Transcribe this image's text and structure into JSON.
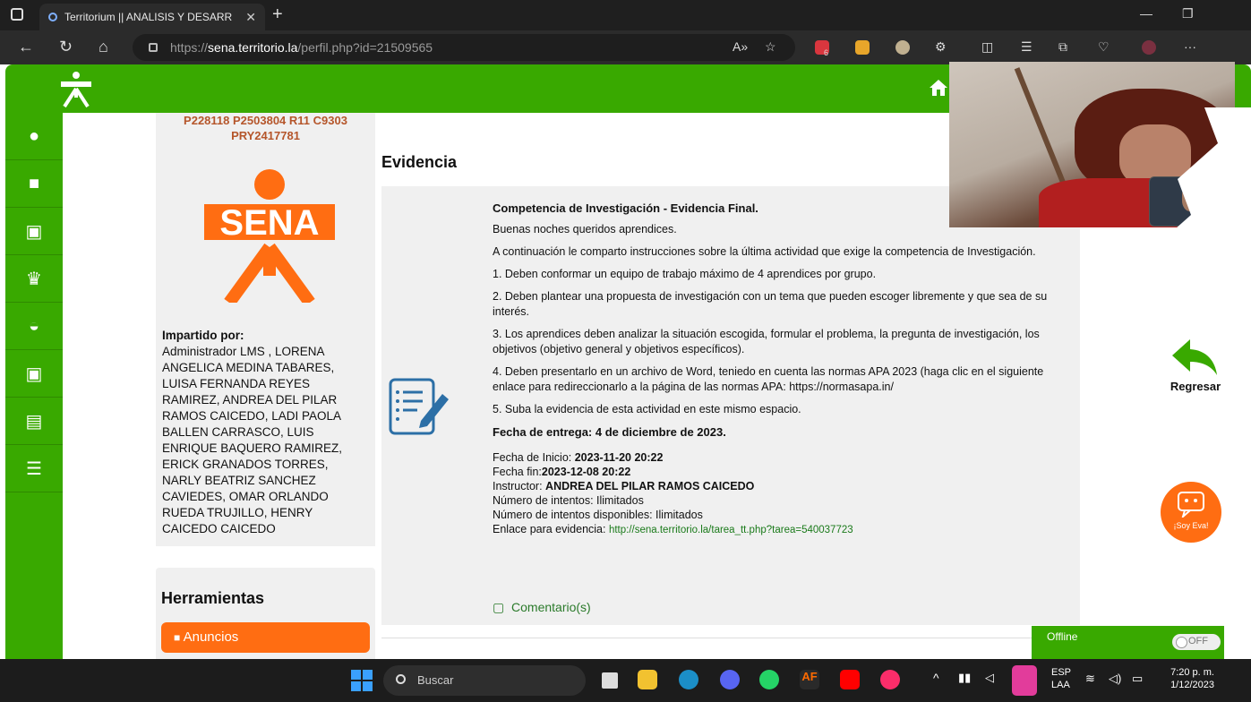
{
  "browser": {
    "tab_title": "Territorium || ANALISIS Y DESARR",
    "url_scheme": "https://",
    "url_host": "sena.territorio.la",
    "url_path": "/perfil.php?id=21509565",
    "extension_badge": "6"
  },
  "left": {
    "codes": "P228118 P2503804 R11 C9303 PRY2417781",
    "logo_text": "SENA",
    "impartido_label": "Impartido por:",
    "impartido_names": "Administrador LMS , LORENA ANGELICA MEDINA TABARES, LUISA FERNANDA REYES RAMIREZ, ANDREA DEL PILAR RAMOS CAICEDO, LADI PAOLA BALLEN CARRASCO, LUIS ENRIQUE BAQUERO RAMIREZ, ERICK GRANADOS TORRES, NARLY BEATRIZ SANCHEZ CAVIEDES, OMAR ORLANDO RUEDA TRUJILLO, HENRY CAICEDO CAICEDO"
  },
  "tools": {
    "title": "Herramientas",
    "anuncios": "Anuncios"
  },
  "evidence": {
    "heading": "Evidencia",
    "title": "Competencia de Investigación - Evidencia Final.",
    "greeting": "Buenas noches queridos aprendices.",
    "intro": "A continuación le comparto instrucciones sobre la última actividad que exige la competencia de Investigación.",
    "item1": " 1. Deben conformar un equipo de trabajo máximo de 4 aprendices por grupo.",
    "item2": "2. Deben plantear una propuesta de investigación con un tema que pueden escoger libremente y que sea de su interés.",
    "item3": "3. Los aprendices deben analizar la  situación escogida, formular el problema, la pregunta de investigación, los objetivos (objetivo general y objetivos específicos).",
    "item4": "4. Deben presentarlo en un archivo de Word, teniedo en cuenta las normas APA 2023 (haga clic en el siguiente enlace para redireccionarlo a la página de las normas APA: https://normasapa.in/",
    "item5": "5. Suba la evidencia de esta actividad en este mismo espacio.",
    "due": "Fecha de entrega: 4 de diciembre de 2023.",
    "start_label": "Fecha de Inicio: ",
    "start_value": "2023-11-20 20:22",
    "end_label": "Fecha fin:",
    "end_value": "2023-12-08 20:22",
    "instructor_label": "Instructor: ",
    "instructor_value": "ANDREA DEL PILAR RAMOS CAICEDO",
    "attempts": "Número de intentos: Ilimitados",
    "attempts_left": "Número de intentos disponibles: Ilimitados",
    "link_label": "Enlace para evidencia: ",
    "link_value": "http://sena.territorio.la/tarea_tt.php?tarea=540037723",
    "comments": "Comentario(s)"
  },
  "actions": {
    "regresar": "Regresar",
    "eva": "¡Soy Eva!",
    "offline": "Offline",
    "toggle": "OFF"
  },
  "taskbar": {
    "search": "Buscar",
    "lang": "ESP",
    "lang2": "LAA",
    "time": "7:20 p. m.",
    "date": "1/12/2023"
  },
  "colors": {
    "sena_green": "#39a900",
    "sena_orange": "#ff6d12"
  }
}
